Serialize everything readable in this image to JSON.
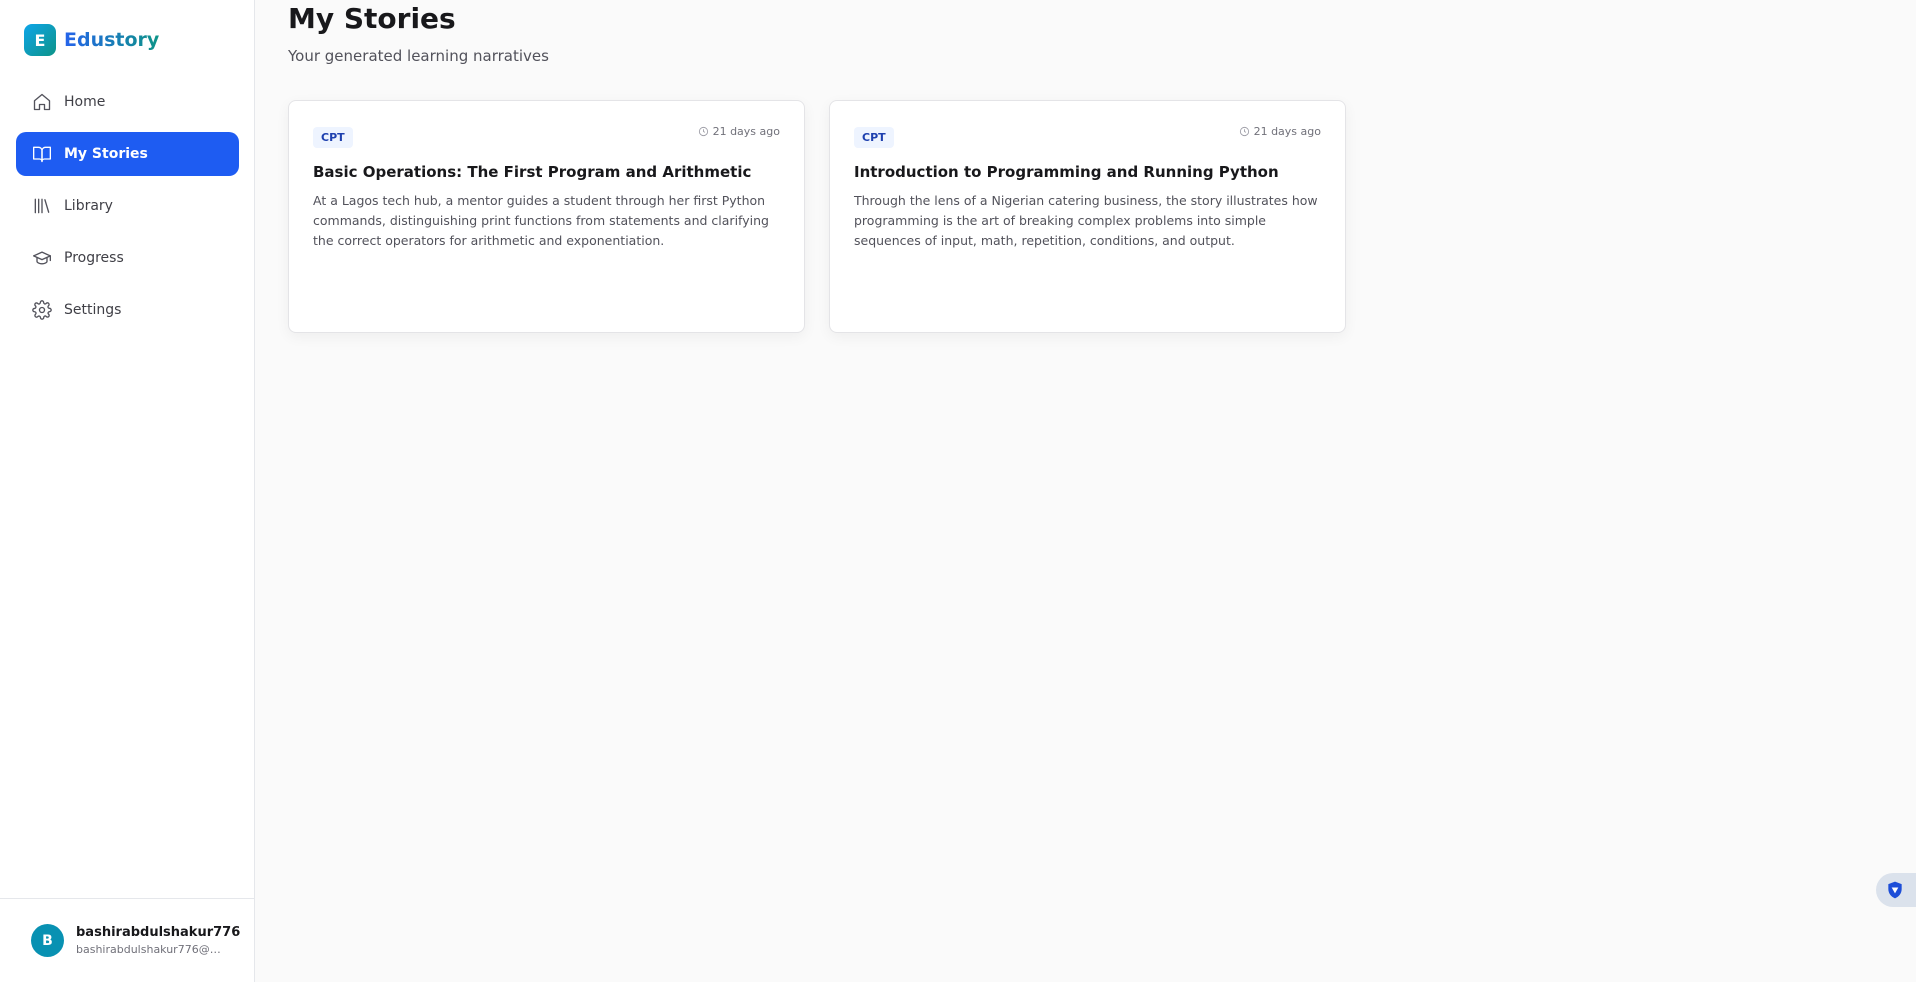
{
  "brand": {
    "letter": "E",
    "name": "Edustory"
  },
  "nav": {
    "items": [
      {
        "label": "Home",
        "icon": "home-icon"
      },
      {
        "label": "My Stories",
        "icon": "book-open-icon"
      },
      {
        "label": "Library",
        "icon": "library-icon"
      },
      {
        "label": "Progress",
        "icon": "graduation-cap-icon"
      },
      {
        "label": "Settings",
        "icon": "gear-icon"
      }
    ],
    "active": "My Stories"
  },
  "user": {
    "initial": "B",
    "name": "bashirabdulshakur776",
    "email": "bashirabdulshakur776@gm..."
  },
  "page": {
    "title": "My Stories",
    "subtitle": "Your generated learning narratives"
  },
  "stories": [
    {
      "badge": "CPT",
      "time": "21 days ago",
      "title": "Basic Operations: The First Program and Arithmetic",
      "description": "At a Lagos tech hub, a mentor guides a student through her first Python commands, distinguishing print functions from statements and clarifying the correct operators for arithmetic and exponentiation."
    },
    {
      "badge": "CPT",
      "time": "21 days ago",
      "title": "Introduction to Programming and Running Python",
      "description": "Through the lens of a Nigerian catering business, the story illustrates how programming is the art of breaking complex problems into simple sequences of input, math, repetition, conditions, and output."
    }
  ],
  "colors": {
    "accent": "#1e5cf2",
    "brand_teal": "#0d9488",
    "avatar": "#0891b2",
    "badge_bg": "#eef4ff"
  }
}
